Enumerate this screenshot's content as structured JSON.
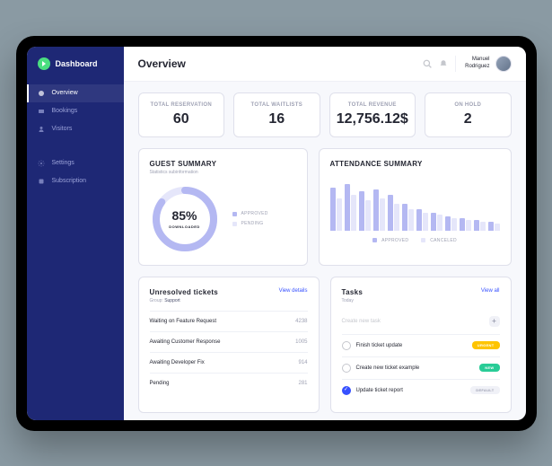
{
  "brand": "Dashboard",
  "header": {
    "title": "Overview",
    "user_first": "Manuel",
    "user_last": "Rodriguez"
  },
  "sidebar": {
    "items": [
      {
        "label": "Overview",
        "active": true
      },
      {
        "label": "Bookings",
        "active": false
      },
      {
        "label": "Visitors",
        "active": false
      }
    ],
    "secondary": [
      {
        "label": "Settings"
      },
      {
        "label": "Subscription"
      }
    ]
  },
  "stats": [
    {
      "label": "TOTAL RESERVATION",
      "value": "60"
    },
    {
      "label": "TOTAL WAITLISTS",
      "value": "16"
    },
    {
      "label": "TOTAL REVENUE",
      "value": "12,756.12$"
    },
    {
      "label": "ON HOLD",
      "value": "2"
    }
  ],
  "guest": {
    "title": "GUEST SUMMARY",
    "sub": "Statistics subinformation",
    "pct": "85%",
    "pct_label": "DOWNLOADED",
    "legend": {
      "approved": "APPROVED",
      "pending": "PENDING"
    },
    "colors": {
      "approved": "#b4b8f2",
      "pending": "#e5e6fa"
    }
  },
  "attendance": {
    "title": "ATTENDANCE SUMMARY",
    "legend": {
      "approved": "APPROVED",
      "canceled": "CANCELED"
    }
  },
  "tickets": {
    "title": "Unresolved tickets",
    "view": "View details",
    "group_label": "Group:",
    "group_value": "Support",
    "rows": [
      {
        "name": "Waiting on Feature Request",
        "count": "4238"
      },
      {
        "name": "Awaiting Customer Response",
        "count": "1005"
      },
      {
        "name": "Awaiting Developer Fix",
        "count": "914"
      },
      {
        "name": "Pending",
        "count": "281"
      }
    ]
  },
  "tasks": {
    "title": "Tasks",
    "sub": "Today",
    "view": "View all",
    "placeholder": "Create new task",
    "rows": [
      {
        "name": "Finish ticket update",
        "badge": "URGENT",
        "badge_class": "urgent",
        "done": false
      },
      {
        "name": "Create new ticket example",
        "badge": "NEW",
        "badge_class": "new",
        "done": false
      },
      {
        "name": "Update ticket report",
        "badge": "DEFAULT",
        "badge_class": "default",
        "done": true
      }
    ]
  },
  "chart_data": {
    "type": "bar",
    "title": "ATTENDANCE SUMMARY",
    "series": [
      {
        "name": "Approved",
        "values": [
          48,
          52,
          44,
          46,
          40,
          30,
          24,
          20,
          16,
          14,
          12,
          10
        ]
      },
      {
        "name": "Canceled",
        "values": [
          36,
          40,
          34,
          36,
          30,
          24,
          20,
          18,
          14,
          12,
          10,
          8
        ]
      }
    ],
    "ylim": [
      0,
      60
    ]
  }
}
